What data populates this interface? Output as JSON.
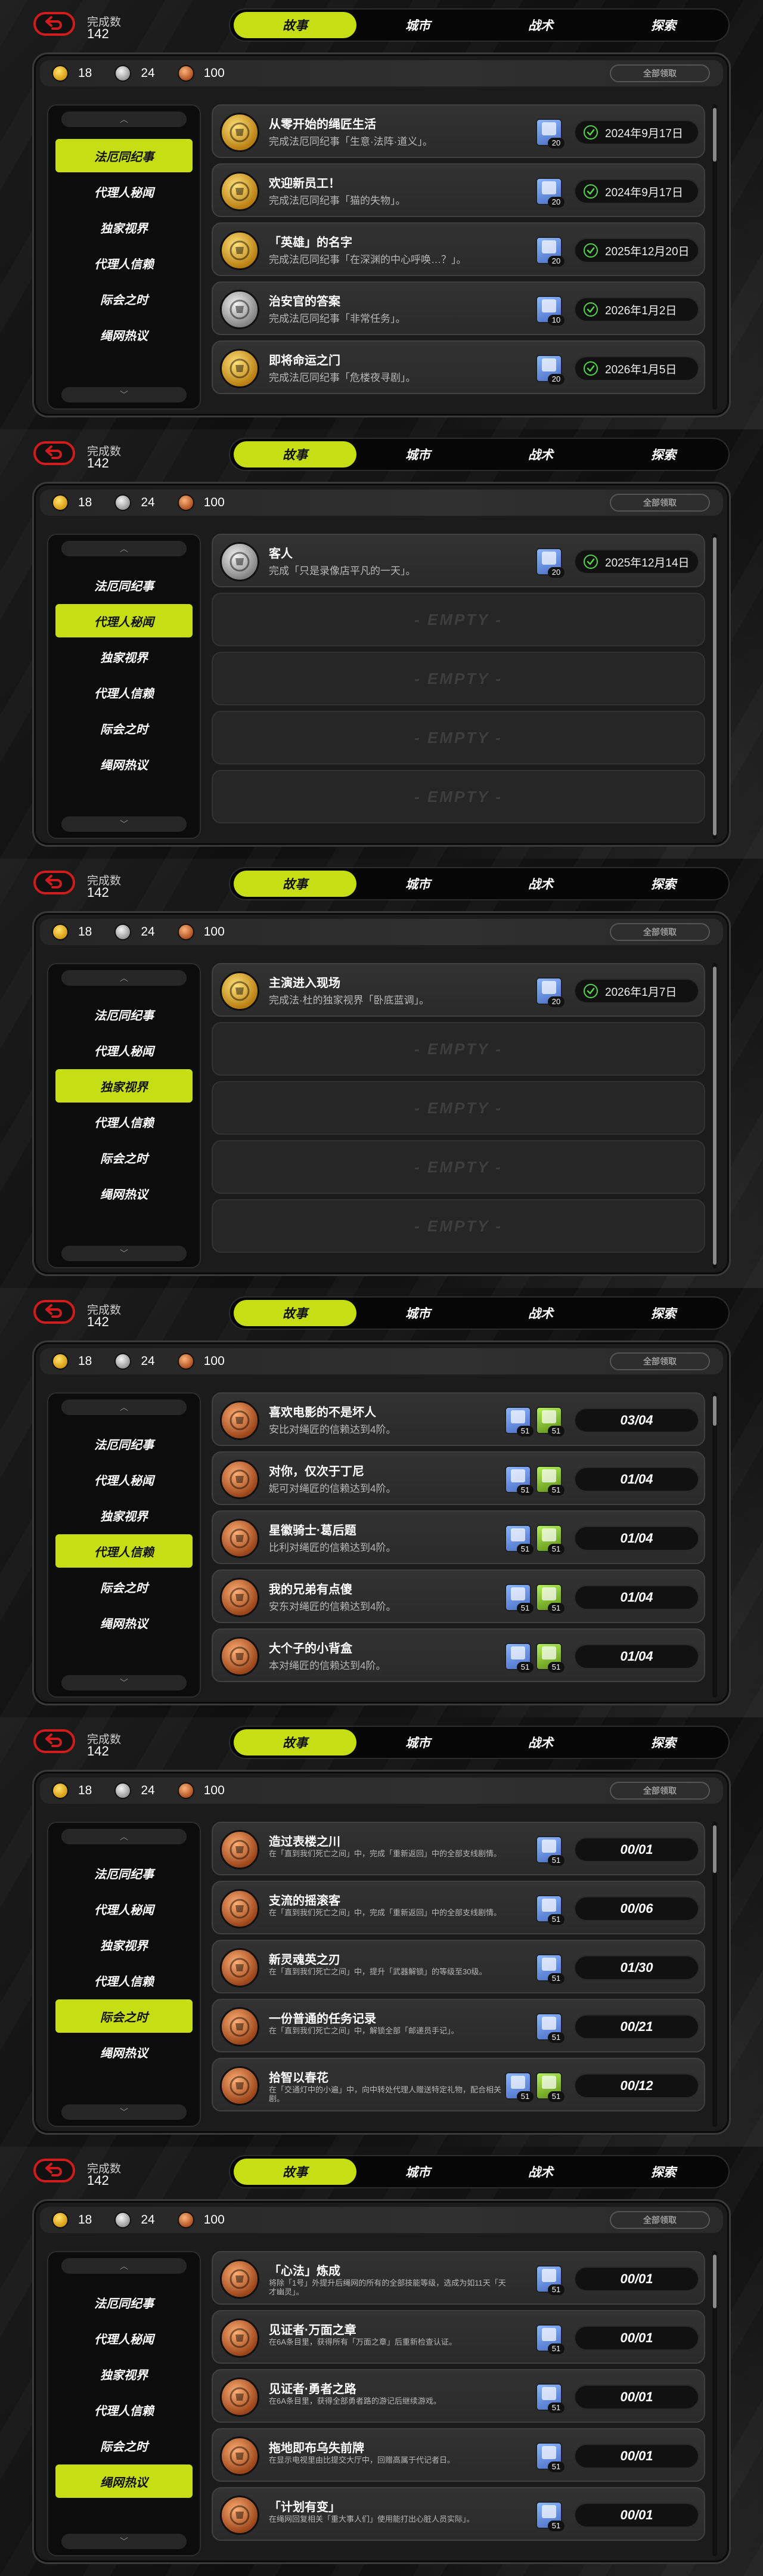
{
  "colors": {
    "accent": "#c6df14",
    "back_red": "#d01c1c",
    "check_green": "#53d24c"
  },
  "header": {
    "done_label": "完成数",
    "done_count": "142"
  },
  "tabs": [
    "故事",
    "城市",
    "战术",
    "探索"
  ],
  "resources": [
    {
      "icon": "gold-medal-icon",
      "value": "18"
    },
    {
      "icon": "silver-medal-icon",
      "value": "24"
    },
    {
      "icon": "copper-medal-icon",
      "value": "100"
    }
  ],
  "claim_all_label": "全部领取",
  "empty_label": "- EMPTY -",
  "screens": [
    {
      "active_tab": 0,
      "active_side": 0,
      "sidebar": [
        "法厄同纪事",
        "代理人秘闻",
        "独家视界",
        "代理人信赖",
        "际会之时",
        "绳网热议"
      ],
      "scroll_thumb": 0.18,
      "cards": [
        {
          "medal": "gold",
          "title": "从零开始的绳匠生活",
          "desc": "完成法厄同纪事「生意·法阵·道义」。",
          "reward": {
            "type": "ticket",
            "qty": "20"
          },
          "status": "done",
          "date": "2024年9月17日"
        },
        {
          "medal": "gold",
          "title": "欢迎新员工！",
          "desc": "完成法厄同纪事「猫的失物」。",
          "reward": {
            "type": "ticket",
            "qty": "20"
          },
          "status": "done",
          "date": "2024年9月17日"
        },
        {
          "medal": "gold",
          "title": "「英雄」的名字",
          "desc": "完成法厄同纪事「在深渊的中心呼唤…？」。",
          "reward": {
            "type": "ticket",
            "qty": "20"
          },
          "status": "done",
          "date": "2025年12月20日"
        },
        {
          "medal": "silver",
          "title": "治安官的答案",
          "desc": "完成法厄同纪事「非常任务」。",
          "reward": {
            "type": "ticket",
            "qty": "10"
          },
          "status": "done",
          "date": "2026年1月2日"
        },
        {
          "medal": "gold",
          "title": "即将命运之门",
          "desc": "完成法厄同纪事「危楼夜寻剧」。",
          "reward": {
            "type": "ticket",
            "qty": "20"
          },
          "status": "done",
          "date": "2026年1月5日"
        }
      ]
    },
    {
      "active_tab": 0,
      "active_side": 1,
      "sidebar": [
        "法厄同纪事",
        "代理人秘闻",
        "独家视界",
        "代理人信赖",
        "际会之时",
        "绳网热议"
      ],
      "scroll_thumb": 1.0,
      "cards": [
        {
          "medal": "silver",
          "title": "客人",
          "desc": "完成「只是录像店平凡的一天」。",
          "reward": {
            "type": "ticket",
            "qty": "20"
          },
          "status": "done",
          "date": "2025年12月14日"
        },
        {
          "empty": true
        },
        {
          "empty": true
        },
        {
          "empty": true
        },
        {
          "empty": true
        }
      ]
    },
    {
      "active_tab": 0,
      "active_side": 2,
      "sidebar": [
        "法厄同纪事",
        "代理人秘闻",
        "独家视界",
        "代理人信赖",
        "际会之时",
        "绳网热议"
      ],
      "scroll_thumb": 1.0,
      "cards": [
        {
          "medal": "gold",
          "title": "主演进入现场",
          "desc": "完成法·杜的独家视界「卧底蓝调」。",
          "reward": {
            "type": "ticket",
            "qty": "20"
          },
          "status": "done",
          "date": "2026年1月7日"
        },
        {
          "empty": true
        },
        {
          "empty": true
        },
        {
          "empty": true
        },
        {
          "empty": true
        }
      ]
    },
    {
      "active_tab": 0,
      "active_side": 3,
      "sidebar": [
        "法厄同纪事",
        "代理人秘闻",
        "独家视界",
        "代理人信赖",
        "际会之时",
        "绳网热议"
      ],
      "scroll_thumb": 0.1,
      "cards": [
        {
          "medal": "copper",
          "title": "喜欢电影的不是坏人",
          "desc": "安比对绳匠的信赖达到4阶。",
          "reward": {
            "type": "dual",
            "qty": "51"
          },
          "status": "progress",
          "progress": "03/04"
        },
        {
          "medal": "copper",
          "title": "对你，仅次于丁尼",
          "desc": "妮可对绳匠的信赖达到4阶。",
          "reward": {
            "type": "dual",
            "qty": "51"
          },
          "status": "progress",
          "progress": "01/04"
        },
        {
          "medal": "copper",
          "title": "星徽骑士·葛后题",
          "desc": "比利对绳匠的信赖达到4阶。",
          "reward": {
            "type": "dual",
            "qty": "51"
          },
          "status": "progress",
          "progress": "01/04"
        },
        {
          "medal": "copper",
          "title": "我的兄弟有点傻",
          "desc": "安东对绳匠的信赖达到4阶。",
          "reward": {
            "type": "dual",
            "qty": "51"
          },
          "status": "progress",
          "progress": "01/04"
        },
        {
          "medal": "copper",
          "title": "大个子的小背盒",
          "desc": "本对绳匠的信赖达到4阶。",
          "reward": {
            "type": "dual",
            "qty": "51"
          },
          "status": "progress",
          "progress": "01/04"
        }
      ]
    },
    {
      "active_tab": 0,
      "active_side": 4,
      "sidebar": [
        "法厄同纪事",
        "代理人秘闻",
        "独家视界",
        "代理人信赖",
        "际会之时",
        "绳网热议"
      ],
      "scroll_thumb": 0.16,
      "cards": [
        {
          "medal": "copper",
          "title": "造过表楼之川",
          "desc": "在「直到我们死亡之间」中，完成「重新返回」中的全部支线剧情。",
          "small": true,
          "reward": {
            "type": "ticket",
            "qty": "51"
          },
          "status": "progress",
          "progress": "00/01"
        },
        {
          "medal": "copper",
          "title": "支流的摇滚客",
          "desc": "在「直到我们死亡之间」中，完成「重新返回」中的全部支线剧情。",
          "small": true,
          "reward": {
            "type": "ticket",
            "qty": "51"
          },
          "status": "progress",
          "progress": "00/06"
        },
        {
          "medal": "copper",
          "title": "新灵魂英之刃",
          "desc": "在「直到我们死亡之间」中，提升「武器解锁」的等级至30级。",
          "small": true,
          "reward": {
            "type": "ticket",
            "qty": "51"
          },
          "status": "progress",
          "progress": "01/30"
        },
        {
          "medal": "copper",
          "title": "一份普通的任务记录",
          "desc": "在「直到我们死亡之间」中，解锁全部「邮递员手记」。",
          "small": true,
          "reward": {
            "type": "ticket",
            "qty": "51"
          },
          "status": "progress",
          "progress": "00/21"
        },
        {
          "medal": "copper",
          "title": "拾智以春花",
          "desc": "在「交通灯中的小遍」中，向中转处代理人赠送特定礼物，配合相关剧。",
          "small": true,
          "reward": {
            "type": "dual",
            "qty": "51"
          },
          "status": "progress",
          "progress": "00/12"
        }
      ]
    },
    {
      "active_tab": 0,
      "active_side": 5,
      "sidebar": [
        "法厄同纪事",
        "代理人秘闻",
        "独家视界",
        "代理人信赖",
        "际会之时",
        "绳网热议"
      ],
      "scroll_thumb": 0.18,
      "cards": [
        {
          "medal": "copper",
          "title": "「心法」炼成",
          "desc": "将除「1号」外提升后绳网的所有的全部技能等级，选成为如11天「天才幽灵」。",
          "small": true,
          "reward": {
            "type": "ticket",
            "qty": "51"
          },
          "status": "progress",
          "progress": "00/01"
        },
        {
          "medal": "copper",
          "title": "见证者·万面之章",
          "desc": "在6A条目里，获得所有「万面之章」后重新检查认证。",
          "small": true,
          "reward": {
            "type": "ticket",
            "qty": "51"
          },
          "status": "progress",
          "progress": "00/01"
        },
        {
          "medal": "copper",
          "title": "见证者·勇者之路",
          "desc": "在6A条目里，获得全部勇者路的游记后继续游戏。",
          "small": true,
          "reward": {
            "type": "ticket",
            "qty": "51"
          },
          "status": "progress",
          "progress": "00/01"
        },
        {
          "medal": "copper",
          "title": "拖地即布乌失前牌",
          "desc": "在显示电视里由比提交大厅中，回赠高属于代记者日。",
          "small": true,
          "reward": {
            "type": "ticket",
            "qty": "51"
          },
          "status": "progress",
          "progress": "00/01"
        },
        {
          "medal": "copper",
          "title": "「计划有变」",
          "desc": "在绳网回复相关「重大事人们」使用能打出心脏人员实际」。",
          "small": true,
          "reward": {
            "type": "ticket",
            "qty": "51"
          },
          "status": "progress",
          "progress": "00/01"
        }
      ]
    }
  ]
}
